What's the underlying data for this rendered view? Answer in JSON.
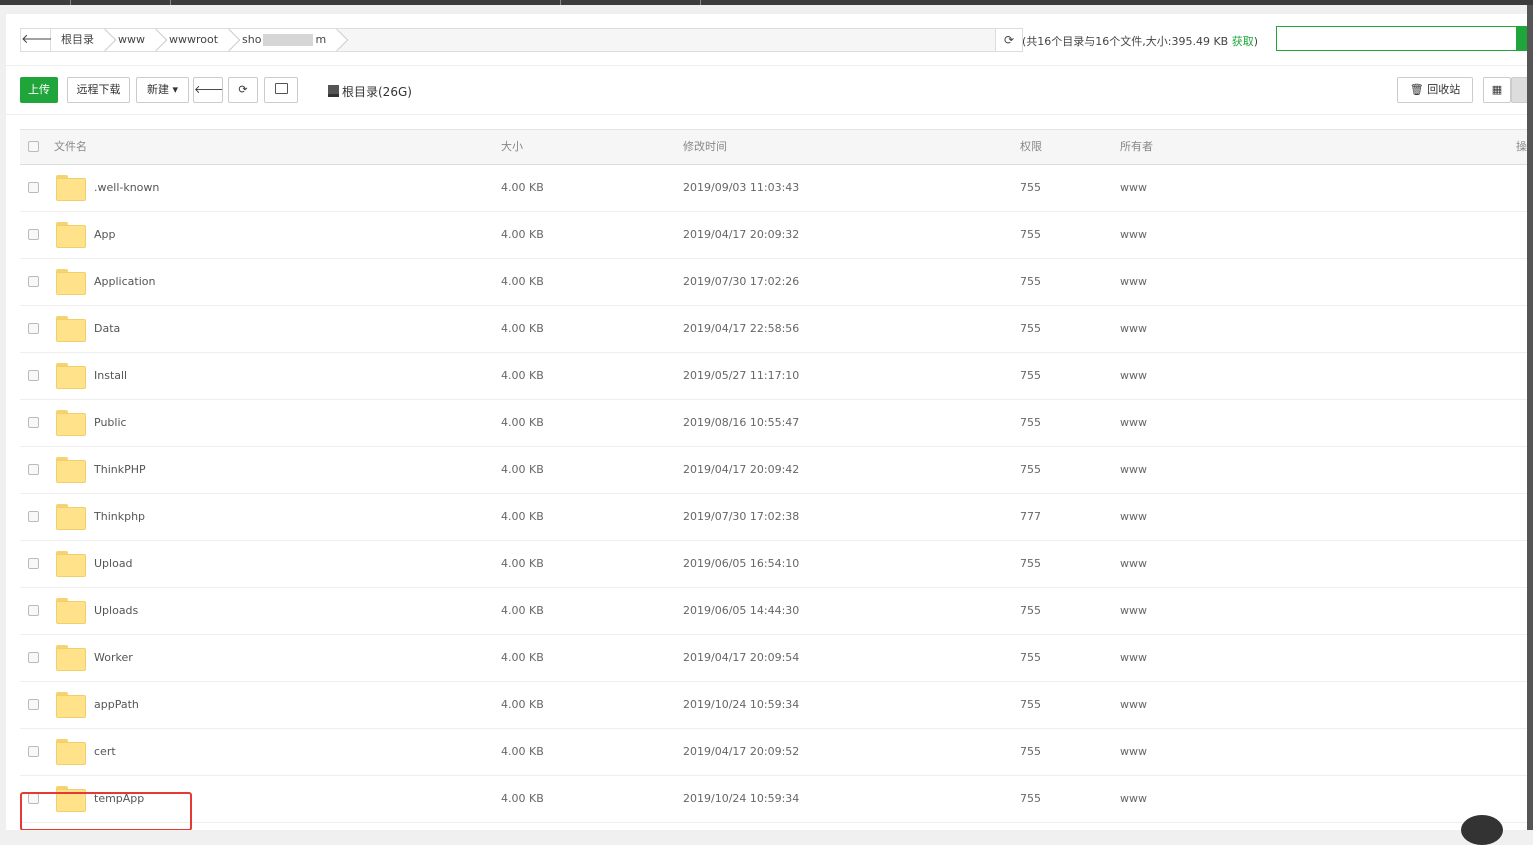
{
  "pathbar": {
    "back_icon": "arrow-left",
    "crumbs": [
      "根目录",
      "www",
      "wwwroot",
      "sho",
      "m"
    ],
    "refresh_icon": "refresh",
    "summary": "(共16个目录与16个文件,大小:395.49 KB",
    "fetch_label": "获取",
    "summary_close": ")"
  },
  "search": {
    "value": ""
  },
  "toolbar": {
    "upload": "上传",
    "remote_download": "远程下载",
    "new": "新建",
    "new_caret": "▾",
    "back_icon": "arrow-left",
    "refresh_icon": "refresh",
    "terminal_icon": "terminal",
    "disk_label": "根目录(26G)",
    "recycle_bin": "回收站",
    "recycle_icon": "trash",
    "grid_icon": "grid-view"
  },
  "table": {
    "headers": {
      "name": "文件名",
      "size": "大小",
      "mtime": "修改时间",
      "perm": "权限",
      "owner": "所有者",
      "op": "操"
    },
    "rows": [
      {
        "name": ".well-known",
        "size": "4.00 KB",
        "mtime": "2019/09/03 11:03:43",
        "perm": "755",
        "owner": "www"
      },
      {
        "name": "App",
        "size": "4.00 KB",
        "mtime": "2019/04/17 20:09:32",
        "perm": "755",
        "owner": "www"
      },
      {
        "name": "Application",
        "size": "4.00 KB",
        "mtime": "2019/07/30 17:02:26",
        "perm": "755",
        "owner": "www"
      },
      {
        "name": "Data",
        "size": "4.00 KB",
        "mtime": "2019/04/17 22:58:56",
        "perm": "755",
        "owner": "www"
      },
      {
        "name": "Install",
        "size": "4.00 KB",
        "mtime": "2019/05/27 11:17:10",
        "perm": "755",
        "owner": "www"
      },
      {
        "name": "Public",
        "size": "4.00 KB",
        "mtime": "2019/08/16 10:55:47",
        "perm": "755",
        "owner": "www"
      },
      {
        "name": "ThinkPHP",
        "size": "4.00 KB",
        "mtime": "2019/04/17 20:09:42",
        "perm": "755",
        "owner": "www"
      },
      {
        "name": "Thinkphp",
        "size": "4.00 KB",
        "mtime": "2019/07/30 17:02:38",
        "perm": "777",
        "owner": "www"
      },
      {
        "name": "Upload",
        "size": "4.00 KB",
        "mtime": "2019/06/05 16:54:10",
        "perm": "755",
        "owner": "www"
      },
      {
        "name": "Uploads",
        "size": "4.00 KB",
        "mtime": "2019/06/05 14:44:30",
        "perm": "755",
        "owner": "www"
      },
      {
        "name": "Worker",
        "size": "4.00 KB",
        "mtime": "2019/04/17 20:09:54",
        "perm": "755",
        "owner": "www"
      },
      {
        "name": "appPath",
        "size": "4.00 KB",
        "mtime": "2019/10/24 10:59:34",
        "perm": "755",
        "owner": "www"
      },
      {
        "name": "cert",
        "size": "4.00 KB",
        "mtime": "2019/04/17 20:09:52",
        "perm": "755",
        "owner": "www"
      },
      {
        "name": "tempApp",
        "size": "4.00 KB",
        "mtime": "2019/10/24 10:59:34",
        "perm": "755",
        "owner": "www"
      }
    ]
  },
  "colors": {
    "accent": "#20a53a",
    "highlight": "#e53935"
  }
}
